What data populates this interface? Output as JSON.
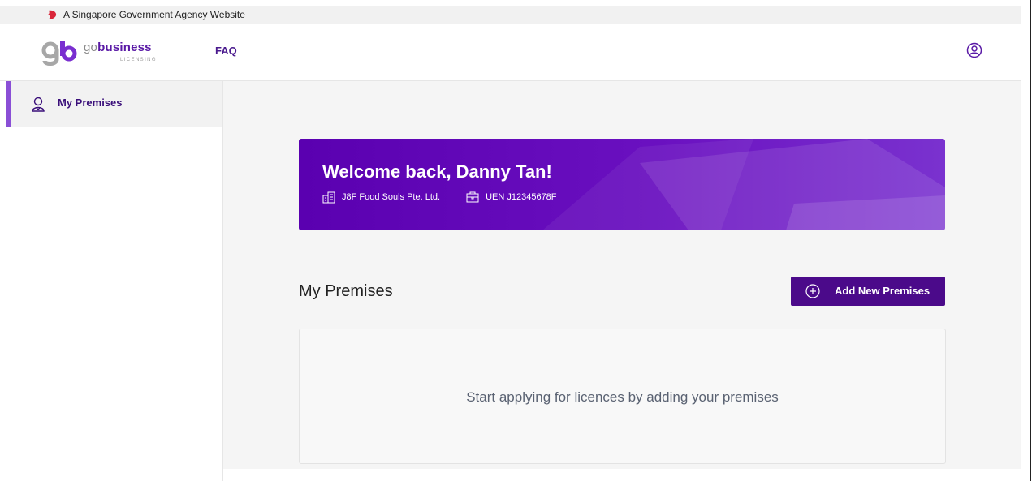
{
  "gov_banner": {
    "text": "A Singapore Government Agency Website",
    "icon": "lion-head-icon"
  },
  "header": {
    "logo": {
      "mark": "gb",
      "brand_prefix": "go",
      "brand_main": "business",
      "sub": "LICENSING"
    },
    "nav": {
      "faq": "FAQ"
    },
    "user_icon": "user-icon"
  },
  "sidebar": {
    "items": [
      {
        "label": "My Premises",
        "icon": "person-icon",
        "active": true
      }
    ]
  },
  "welcome": {
    "title": "Welcome back, Danny Tan!",
    "company": "J8F Food Souls Pte. Ltd.",
    "uen": "UEN J12345678F"
  },
  "premises": {
    "title": "My Premises",
    "add_button": "Add New Premises",
    "empty_message": "Start applying for licences by adding your premises"
  },
  "colors": {
    "primary": "#4b0a8a",
    "banner": "#5a00b0",
    "accent_border": "#8a4fd6"
  }
}
